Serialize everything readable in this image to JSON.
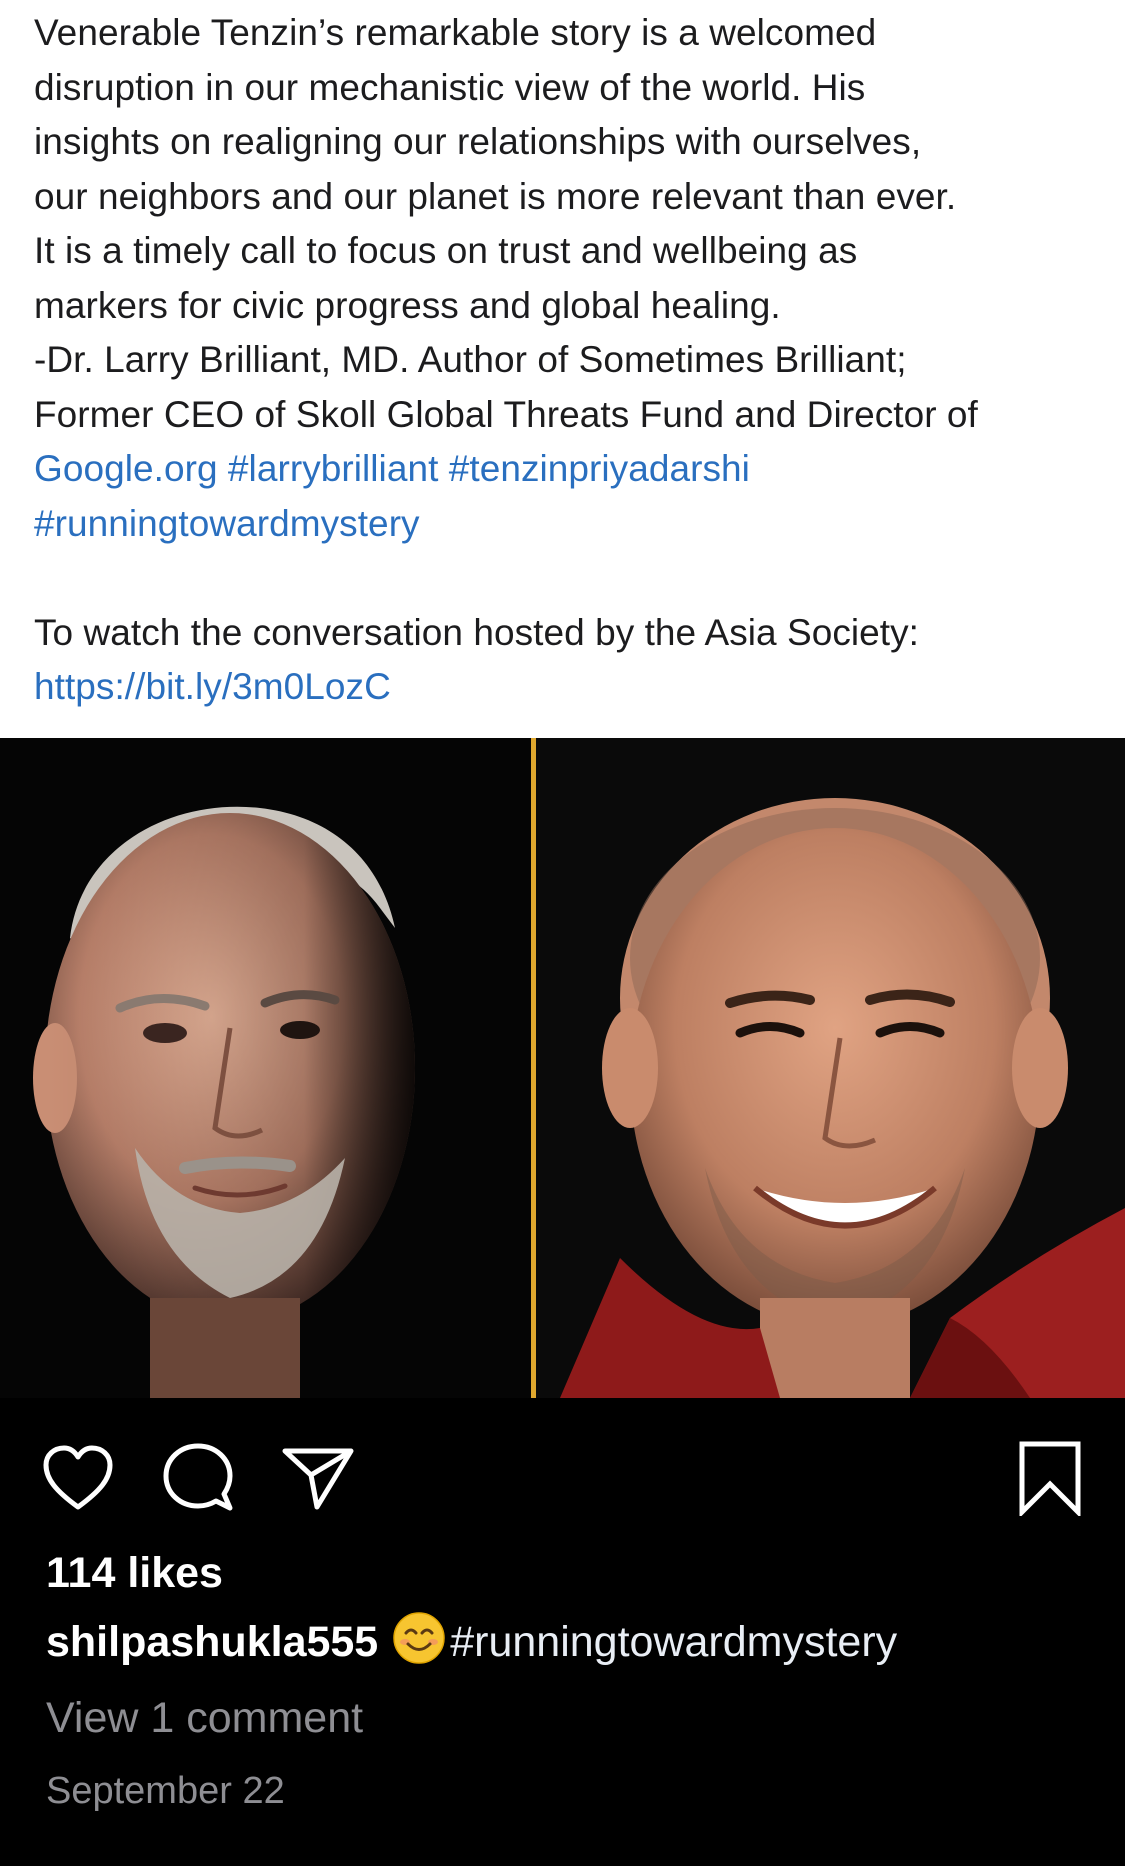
{
  "caption": {
    "lines": [
      "Venerable Tenzin’s remarkable story is a welcomed",
      "disruption in our mechanistic view of the world. His",
      "insights on realigning our relationships with ourselves,",
      "our neighbors and our planet is more relevant than ever.",
      "It is a timely call to focus on trust and wellbeing as",
      "markers for civic progress and global healing.",
      "-Dr. Larry Brilliant, MD. Author of Sometimes Brilliant;",
      "Former CEO of Skoll Global Threats Fund and Director of"
    ],
    "link_google": "Google.org",
    "hashtag_larry": "#larrybrilliant",
    "hashtag_tenzin": "#tenzinpriyadarshi",
    "hashtag_running": "#runningtowardmystery",
    "watch_text": "To watch the conversation hosted by the Asia Society:",
    "watch_url": "https://bit.ly/3m0LozC"
  },
  "photo": {
    "left_person": "portrait-older-man",
    "right_person": "portrait-monk-smiling",
    "divider_color": "#e0a82e"
  },
  "actions": {
    "like_icon": "heart-icon",
    "comment_icon": "comment-icon",
    "share_icon": "paper-plane-icon",
    "save_icon": "bookmark-icon"
  },
  "post": {
    "likes": "114 likes",
    "username": "shilpashukla555",
    "emoji": "smiling-face-emoji",
    "tag": "#runningtowardmystery",
    "view_comments": "View 1 comment",
    "date": "September 22"
  },
  "colors": {
    "link": "#2a6fbf",
    "background": "#000000",
    "caption_bg": "#ffffff",
    "muted": "#8e8e93"
  }
}
